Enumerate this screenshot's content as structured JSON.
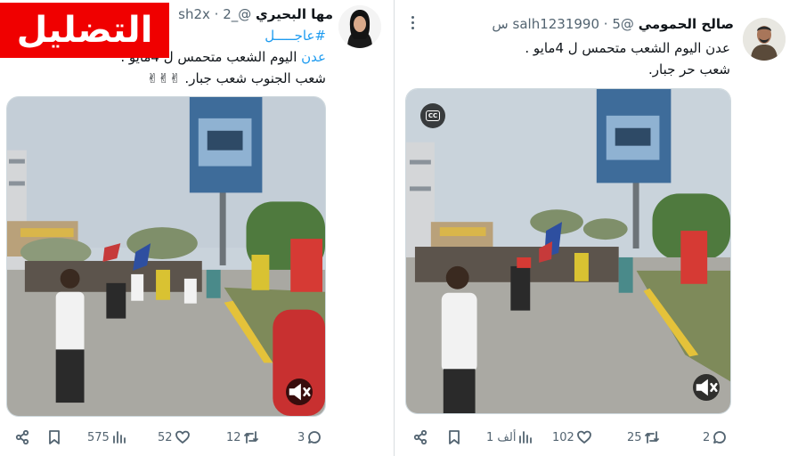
{
  "stamp": {
    "label": "التضليل",
    "color": "#f00000"
  },
  "colors": {
    "link": "#1d9bf0",
    "muted": "#536471",
    "text": "#0f1419"
  },
  "tweets": [
    {
      "display_name": "مها البحيري",
      "handle": "@_sh2x",
      "separator": "·",
      "time": "2",
      "text_line1": "#عاجـــــل",
      "text_line2_link": "عدن",
      "text_line2_rest": "اليوم الشعب متحمس ل 4مايو",
      "text_line2_period": ".",
      "text_line3": "شعب الجنوب شعب جبار. ✌✌✌",
      "media_icons": [
        "mute-icon"
      ],
      "actions": {
        "reply_count": "3",
        "retweet_count": "12",
        "like_count": "52",
        "views_count": "575"
      }
    },
    {
      "display_name": "صالح الحمومي",
      "handle": "@salh1231990",
      "separator": "·",
      "time": "5 س",
      "text_line1": "عدن اليوم الشعب متحمس ل 4مايو .",
      "text_line2": "شعب حر جبار.",
      "cc_label": "CC",
      "media_icons": [
        "cc-icon",
        "mute-icon"
      ],
      "actions": {
        "reply_count": "2",
        "retweet_count": "25",
        "like_count": "102",
        "views_count": "1 ألف"
      }
    }
  ]
}
